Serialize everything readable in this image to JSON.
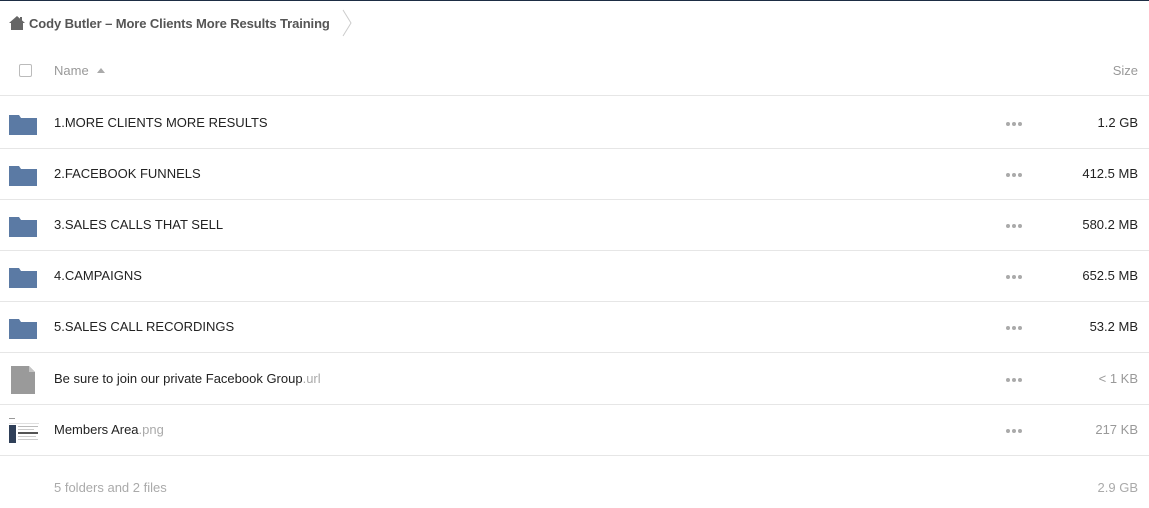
{
  "breadcrumb": {
    "title": "Cody Butler – More Clients More Results Training"
  },
  "table": {
    "name_header": "Name",
    "size_header": "Size",
    "rows": [
      {
        "name": "1.MORE CLIENTS MORE RESULTS",
        "ext": "",
        "size": "1.2 GB",
        "type": "folder"
      },
      {
        "name": "2.FACEBOOK FUNNELS",
        "ext": "",
        "size": "412.5 MB",
        "type": "folder"
      },
      {
        "name": "3.SALES CALLS THAT SELL",
        "ext": "",
        "size": "580.2 MB",
        "type": "folder"
      },
      {
        "name": "4.CAMPAIGNS",
        "ext": "",
        "size": "652.5 MB",
        "type": "folder"
      },
      {
        "name": "5.SALES CALL RECORDINGS",
        "ext": "",
        "size": "53.2 MB",
        "type": "folder"
      },
      {
        "name": "Be sure to join our private Facebook Group",
        "ext": ".url",
        "size": "< 1 KB",
        "type": "file"
      },
      {
        "name": "Members Area",
        "ext": ".png",
        "size": "217 KB",
        "type": "image"
      }
    ]
  },
  "footer": {
    "summary": "5 folders and 2 files",
    "total": "2.9 GB"
  },
  "colors": {
    "folder": "#5b7aa4",
    "file": "#9a9a9a",
    "muted_text": "#aaaaaa"
  }
}
